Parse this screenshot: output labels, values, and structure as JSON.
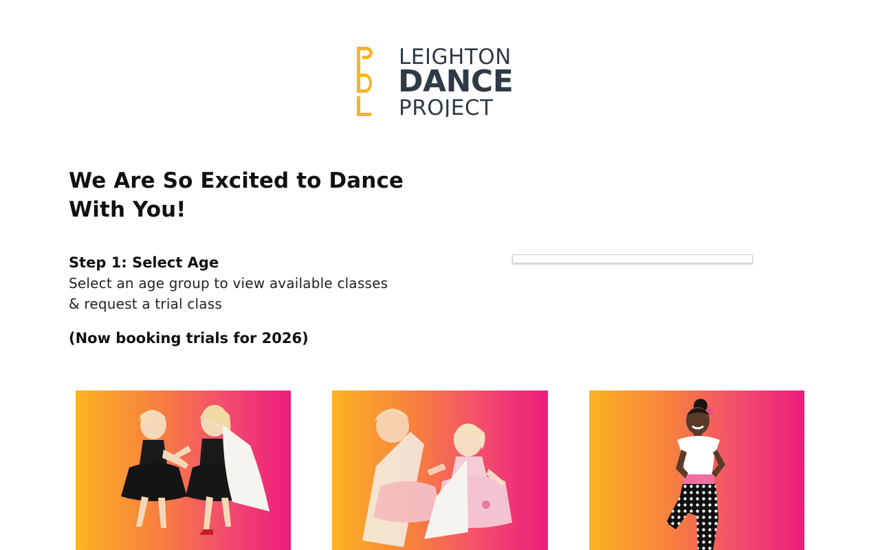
{
  "logo": {
    "mark": "LDP",
    "line1": "LEIGHTON",
    "line2": "DANCE",
    "line3": "PROJECT"
  },
  "hero": {
    "headline_line1": "We Are So Excited to Dance",
    "headline_line2": "With You!"
  },
  "step": {
    "title": "Step 1: Select Age",
    "description_line1": "Select an age group to view available classes",
    "description_line2": "& request a trial class",
    "note": "(Now booking trials for 2026)"
  },
  "age_cards": [
    {
      "icon": "two-toddlers-dancing-black-tutus-image"
    },
    {
      "icon": "two-toddlers-dancing-pink-tutus-image"
    },
    {
      "icon": "girl-posing-polka-dot-pants-image"
    }
  ],
  "colors": {
    "logo_yellow": "#f9b424",
    "logo_navy": "#2e3a45",
    "gradient_start": "#fcb321",
    "gradient_end": "#ee1b7c"
  }
}
